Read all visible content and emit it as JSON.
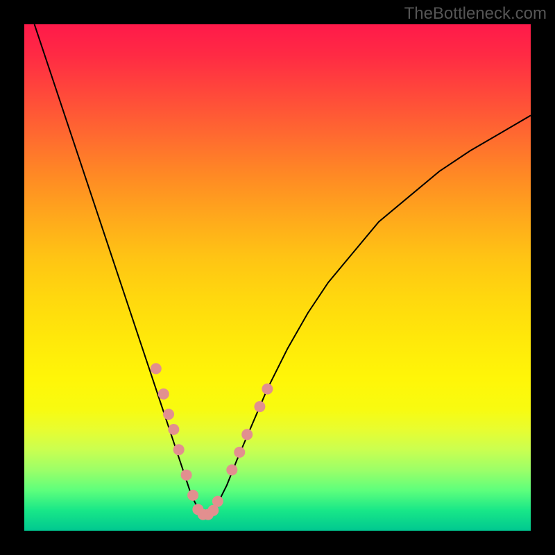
{
  "watermark": "TheBottleneck.com",
  "chart_data": {
    "type": "line",
    "title": "",
    "xlabel": "",
    "ylabel": "",
    "xlim": [
      0,
      100
    ],
    "ylim": [
      0,
      100
    ],
    "curve": {
      "name": "bottleneck-curve",
      "color": "#000000",
      "width": 2,
      "x": [
        2,
        5,
        8,
        11,
        14,
        17,
        20,
        23,
        25,
        27,
        29,
        31,
        32,
        33,
        34,
        35,
        36,
        37,
        38,
        40,
        42,
        45,
        48,
        52,
        56,
        60,
        65,
        70,
        76,
        82,
        88,
        94,
        100
      ],
      "y": [
        100,
        91,
        82,
        73,
        64,
        55,
        46,
        37,
        31,
        25,
        19,
        13,
        10,
        7,
        5,
        3.5,
        3,
        3.5,
        5,
        9,
        14,
        21,
        28,
        36,
        43,
        49,
        55,
        61,
        66,
        71,
        75,
        78.5,
        82
      ]
    },
    "dots": {
      "name": "highlight-dots",
      "color": "#e28f8f",
      "radius": 8,
      "points": [
        {
          "x": 26,
          "y": 32
        },
        {
          "x": 27.5,
          "y": 27
        },
        {
          "x": 28.5,
          "y": 23
        },
        {
          "x": 29.5,
          "y": 20
        },
        {
          "x": 30.5,
          "y": 16
        },
        {
          "x": 32,
          "y": 11
        },
        {
          "x": 33.3,
          "y": 7
        },
        {
          "x": 34.3,
          "y": 4.2
        },
        {
          "x": 35.3,
          "y": 3.2
        },
        {
          "x": 36.3,
          "y": 3.2
        },
        {
          "x": 37.3,
          "y": 4
        },
        {
          "x": 38.2,
          "y": 5.8
        },
        {
          "x": 41,
          "y": 12
        },
        {
          "x": 42.5,
          "y": 15.5
        },
        {
          "x": 44,
          "y": 19
        },
        {
          "x": 46.5,
          "y": 24.5
        },
        {
          "x": 48,
          "y": 28
        }
      ]
    },
    "gradient_stops": [
      {
        "pos": 0,
        "color": "#ff1a4a"
      },
      {
        "pos": 25,
        "color": "#ff7a28"
      },
      {
        "pos": 50,
        "color": "#ffd010"
      },
      {
        "pos": 75,
        "color": "#f5fc10"
      },
      {
        "pos": 100,
        "color": "#00c890"
      }
    ]
  }
}
